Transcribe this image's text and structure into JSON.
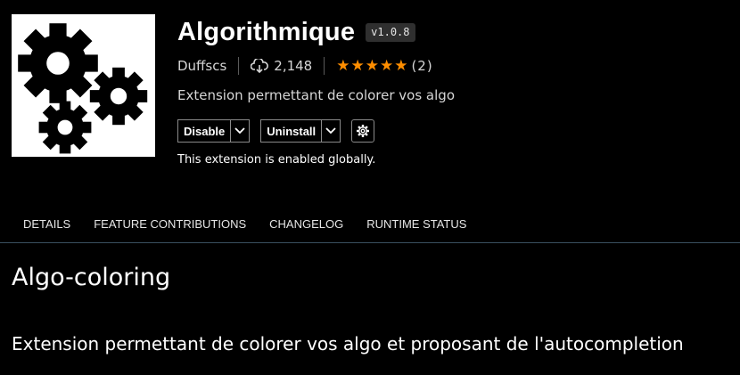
{
  "extension": {
    "name": "Algorithmique",
    "version": "v1.0.8",
    "publisher": "Duffscs",
    "installs": "2,148",
    "stars": "★★★★★",
    "rating_count": "(2)",
    "description": "Extension permettant de colorer vos algo",
    "status": "This extension is enabled globally."
  },
  "buttons": {
    "disable": "Disable",
    "uninstall": "Uninstall"
  },
  "tabs": [
    "DETAILS",
    "FEATURE CONTRIBUTIONS",
    "CHANGELOG",
    "RUNTIME STATUS"
  ],
  "readme": {
    "heading": "Algo-coloring",
    "paragraph": "Extension permettant de colorer vos algo et proposant de l'autocompletion"
  },
  "icons": {
    "logo": "gears-logo-icon",
    "download": "cloud-download-icon",
    "caret": "chevron-down-icon",
    "settings": "gear-icon"
  },
  "colors": {
    "background": "#000000",
    "star": "#ff8e00",
    "tab_border": "#3a5060"
  }
}
